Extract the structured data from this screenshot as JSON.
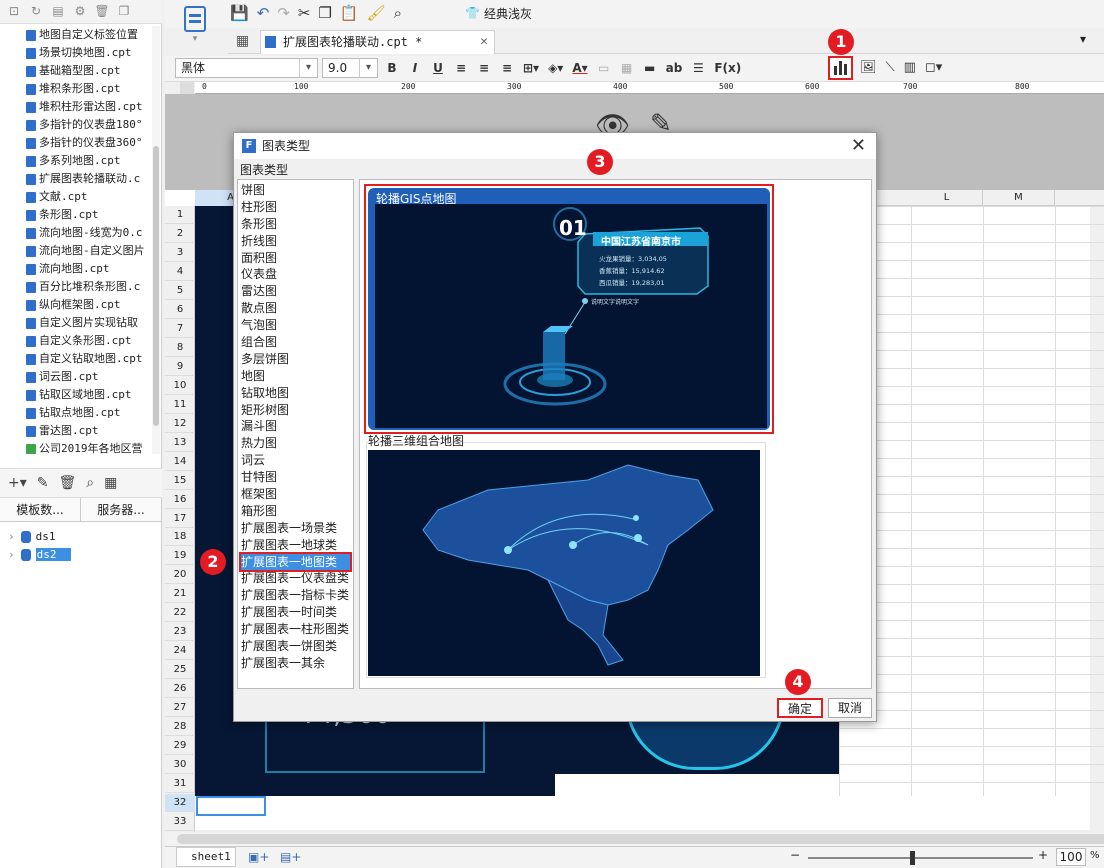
{
  "left_panel": {
    "files": [
      {
        "name": "地图自定义标签位置",
        "type": "cpt"
      },
      {
        "name": "场景切换地图.cpt",
        "type": "cpt"
      },
      {
        "name": "基础箱型图.cpt",
        "type": "cpt"
      },
      {
        "name": "堆积条形图.cpt",
        "type": "cpt"
      },
      {
        "name": "堆积柱形雷达图.cpt",
        "type": "cpt"
      },
      {
        "name": "多指针的仪表盘180°",
        "type": "cpt"
      },
      {
        "name": "多指针的仪表盘360°",
        "type": "cpt"
      },
      {
        "name": "多系列地图.cpt",
        "type": "cpt"
      },
      {
        "name": "扩展图表轮播联动.c",
        "type": "cpt"
      },
      {
        "name": "文献.cpt",
        "type": "cpt"
      },
      {
        "name": "条形图.cpt",
        "type": "cpt"
      },
      {
        "name": "流向地图-线宽为0.c",
        "type": "cpt"
      },
      {
        "name": "流向地图-自定义图片",
        "type": "cpt"
      },
      {
        "name": "流向地图.cpt",
        "type": "cpt"
      },
      {
        "name": "百分比堆积条形图.c",
        "type": "cpt"
      },
      {
        "name": "纵向框架图.cpt",
        "type": "cpt"
      },
      {
        "name": "自定义图片实现钻取",
        "type": "cpt"
      },
      {
        "name": "自定义条形图.cpt",
        "type": "cpt"
      },
      {
        "name": "自定义钻取地图.cpt",
        "type": "cpt"
      },
      {
        "name": "词云图.cpt",
        "type": "cpt"
      },
      {
        "name": "钻取区域地图.cpt",
        "type": "cpt"
      },
      {
        "name": "钻取点地图.cpt",
        "type": "cpt"
      },
      {
        "name": "雷达图.cpt",
        "type": "cpt"
      },
      {
        "name": "公司2019年各地区营",
        "type": "xls"
      }
    ],
    "ds_tabs": [
      "模板数...",
      "服务器..."
    ],
    "datasets": [
      "ds1",
      "ds2"
    ]
  },
  "toolbar": {
    "classic_label": "经典浅灰",
    "doc_tab": "扩展图表轮播联动.cpt *",
    "font_name": "黑体",
    "font_size": "9.0",
    "bold": "B",
    "italic": "I",
    "underline": "U",
    "text_btn": "ab",
    "formula_btn": "F(x)"
  },
  "ruler": [
    "0",
    "100",
    "200",
    "300",
    "400",
    "500",
    "600",
    "700",
    "800"
  ],
  "columns": [
    "A",
    "L",
    "M"
  ],
  "rows": [
    "1",
    "2",
    "3",
    "4",
    "5",
    "6",
    "7",
    "8",
    "9",
    "10",
    "11",
    "12",
    "13",
    "14",
    "15",
    "16",
    "17",
    "18",
    "19",
    "20",
    "21",
    "22",
    "23",
    "24",
    "25",
    "26",
    "27",
    "28",
    "29",
    "30",
    "31",
    "32",
    "33"
  ],
  "sheet": {
    "big_number": "¥4,500",
    "sheet_tab": "sheet1",
    "zoom": "100",
    "zoom_unit": "%"
  },
  "dialog": {
    "title": "图表类型",
    "caption": "图表类型",
    "types": [
      "饼图",
      "柱形图",
      "条形图",
      "折线图",
      "面积图",
      "仪表盘",
      "雷达图",
      "散点图",
      "气泡图",
      "组合图",
      "多层饼图",
      "地图",
      "钻取地图",
      "矩形树图",
      "漏斗图",
      "热力图",
      "词云",
      "甘特图",
      "框架图",
      "箱形图",
      "扩展图表一场景类",
      "扩展图表一地球类",
      "扩展图表一地图类",
      "扩展图表一仪表盘类",
      "扩展图表一指标卡类",
      "扩展图表一时间类",
      "扩展图表一柱形图类",
      "扩展图表一饼图类",
      "扩展图表一其余"
    ],
    "selected_type": "扩展图表一地图类",
    "preview1": {
      "label": "轮播GIS点地图",
      "index": "01",
      "city": "中国江苏省南京市",
      "lines": [
        "火龙果销量：3,034,05",
        "香蕉销量：15,914.62",
        "西瓜销量：19,283,01"
      ],
      "note": "说明文字说明文字"
    },
    "preview2": {
      "label": "轮播三维组合地图"
    },
    "ok": "确定",
    "cancel": "取消"
  },
  "badges": [
    "1",
    "2",
    "3",
    "4"
  ],
  "colors": {
    "accent": "#3d8fe3",
    "badge": "#e31b23",
    "dark_bg": "#061635",
    "cyan": "#23c6e8"
  }
}
